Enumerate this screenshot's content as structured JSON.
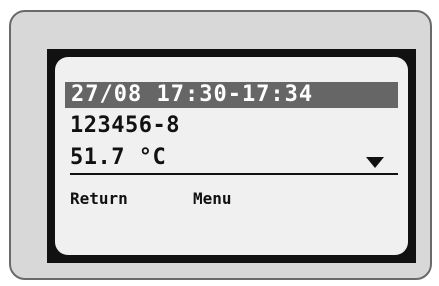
{
  "display": {
    "header": "27/08 17:30-17:34",
    "id_line": "123456-8",
    "value_line": "51.7 °C",
    "dropdown_icon": "triangle-down-icon"
  },
  "softkeys": {
    "left_label": "Return",
    "right_label": "Menu"
  },
  "colors": {
    "device_body": "#d8d8d8",
    "bezel": "#111111",
    "screen": "#f0f0f0",
    "header_highlight": "#666666",
    "text": "#111111"
  }
}
